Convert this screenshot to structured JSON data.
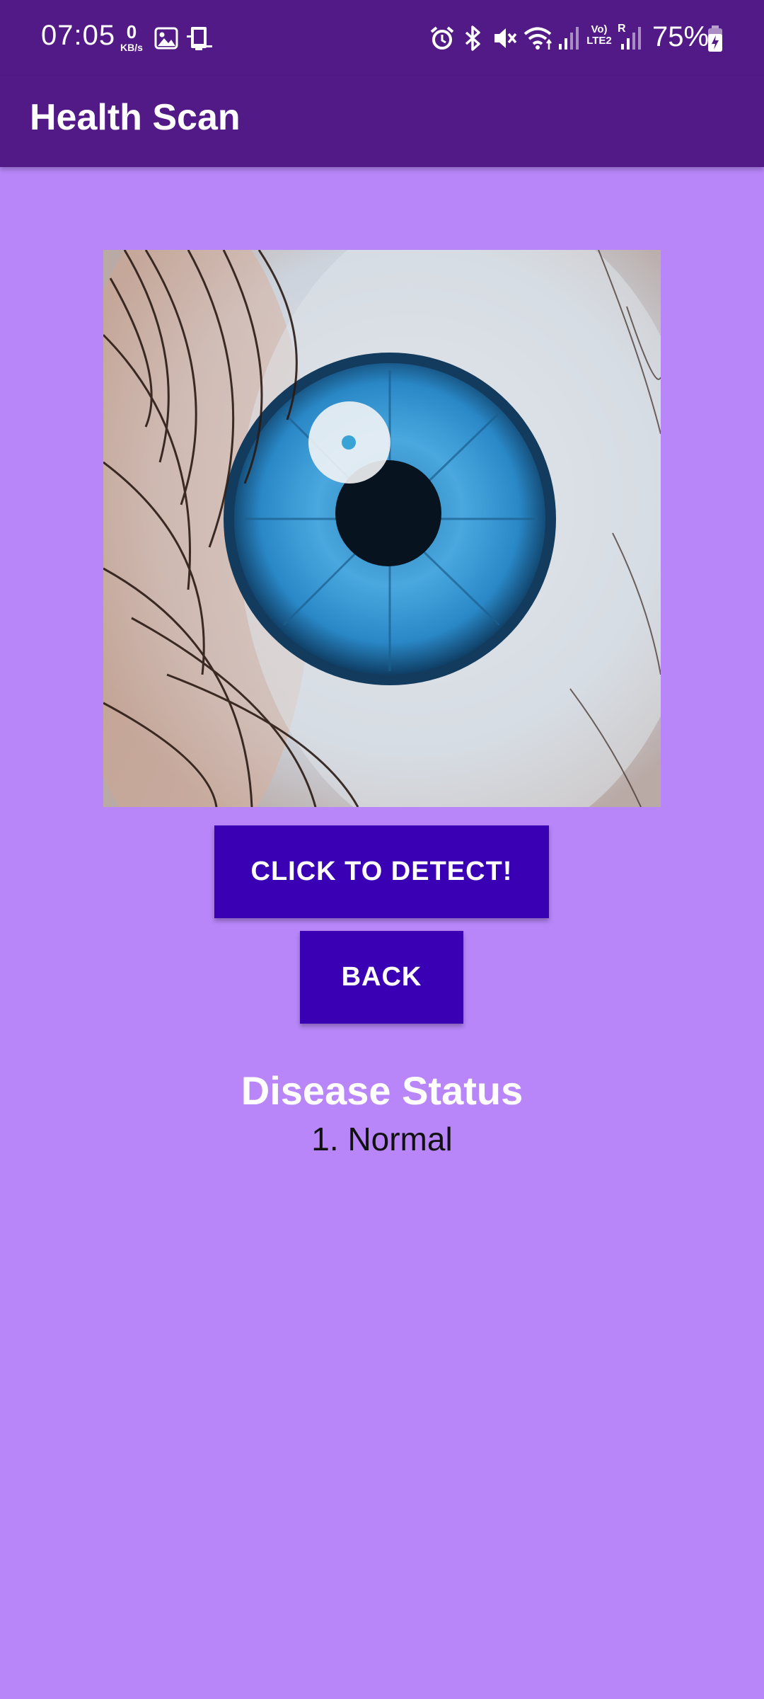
{
  "status_bar": {
    "time": "07:05",
    "net_speed_value": "0",
    "net_speed_unit": "KB/s",
    "network_label": "Vo) LTE2",
    "roaming_label": "R",
    "battery_percent": "75%",
    "icons": [
      "gallery-icon",
      "cast-icon",
      "alarm-icon",
      "bluetooth-icon",
      "mute-icon",
      "wifi-icon",
      "signal-icon",
      "battery-charging-icon"
    ]
  },
  "app_bar": {
    "title": "Health Scan",
    "background": "#521a86"
  },
  "main": {
    "background": "#b886f9",
    "image_subject": "eye-photo",
    "detect_button_label": "CLICK TO DETECT!",
    "back_button_label": "BACK",
    "button_color": "#3a00b4",
    "result_heading": "Disease Status",
    "result_value": "1. Normal"
  }
}
